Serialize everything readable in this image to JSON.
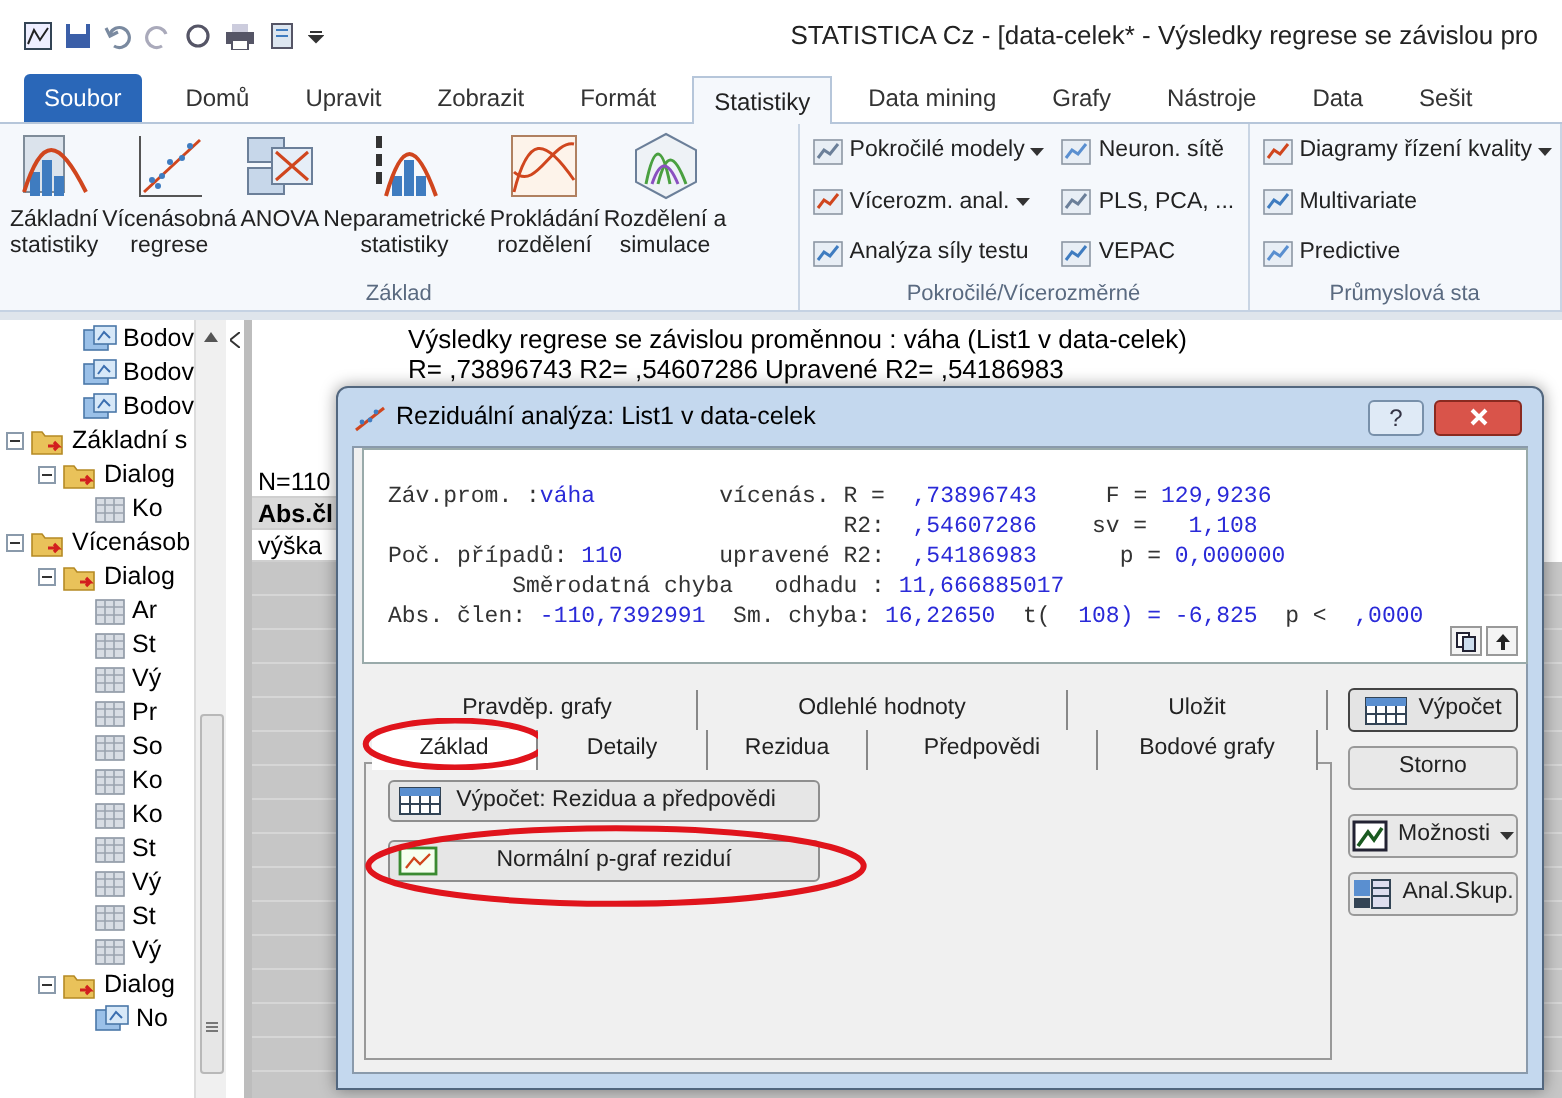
{
  "window": {
    "title": "STATISTICA Cz - [data-celek* - Výsledky regrese se závislou pro"
  },
  "ribbon_tabs": [
    {
      "label": "Soubor",
      "kind": "file",
      "selected": false
    },
    {
      "label": "Domů",
      "kind": "tab",
      "selected": false
    },
    {
      "label": "Upravit",
      "kind": "tab",
      "selected": false
    },
    {
      "label": "Zobrazit",
      "kind": "tab",
      "selected": false
    },
    {
      "label": "Formát",
      "kind": "tab",
      "selected": false
    },
    {
      "label": "Statistiky",
      "kind": "tab",
      "selected": true
    },
    {
      "label": "Data mining",
      "kind": "tab",
      "selected": false
    },
    {
      "label": "Grafy",
      "kind": "tab",
      "selected": false
    },
    {
      "label": "Nástroje",
      "kind": "tab",
      "selected": false
    },
    {
      "label": "Data",
      "kind": "tab",
      "selected": false
    },
    {
      "label": "Sešit",
      "kind": "tab",
      "selected": false
    }
  ],
  "ribbon_groups": [
    {
      "label": "Základ",
      "kind": "large",
      "items": [
        {
          "line1": "Základní",
          "line2": "statistiky"
        },
        {
          "line1": "Vícenásobná",
          "line2": "regrese"
        },
        {
          "line1": "ANOVA"
        },
        {
          "line1": "Neparametrické",
          "line2": "statistiky"
        },
        {
          "line1": "Prokládání",
          "line2": "rozdělení"
        },
        {
          "line1": "Rozdělení a",
          "line2": "simulace"
        }
      ]
    },
    {
      "label": "Pokročilé/Vícerozměrné",
      "kind": "small",
      "items": [
        {
          "label": "Pokročilé modely",
          "dropdown": true
        },
        {
          "label": "Vícerozm. anal.",
          "dropdown": true
        },
        {
          "label": "Analýza síly testu",
          "dropdown": false
        },
        {
          "label": "Neuron. sítě",
          "dropdown": false
        },
        {
          "label": "PLS, PCA, ...",
          "dropdown": false
        },
        {
          "label": "VEPAC",
          "dropdown": false
        }
      ]
    },
    {
      "label": "Průmyslová sta",
      "kind": "small",
      "items": [
        {
          "label": "Diagramy řízení kvality",
          "dropdown": true
        },
        {
          "label": "Multivariate",
          "dropdown": false
        },
        {
          "label": "Predictive",
          "dropdown": false
        }
      ]
    }
  ],
  "tree": {
    "continued_items": [
      {
        "label": "Bodov",
        "kind": "graph"
      },
      {
        "label": "Bodov",
        "kind": "graph"
      },
      {
        "label": "Bodov",
        "kind": "graph"
      }
    ],
    "nodes": [
      {
        "label": "Základní s",
        "kind": "folder",
        "expanded": true,
        "children": [
          {
            "label": "Dialog",
            "kind": "folder",
            "expanded": true,
            "children": [
              {
                "label": "Ko",
                "kind": "sheet"
              }
            ]
          }
        ]
      },
      {
        "label": "Vícenásob",
        "kind": "folder",
        "expanded": true,
        "children": [
          {
            "label": "Dialog",
            "kind": "folder",
            "expanded": true,
            "children": [
              {
                "label": "Ar",
                "kind": "sheet"
              },
              {
                "label": "St",
                "kind": "sheet"
              },
              {
                "label": "Vý",
                "kind": "sheet"
              },
              {
                "label": "Pr",
                "kind": "sheet"
              },
              {
                "label": "So",
                "kind": "sheet"
              },
              {
                "label": "Ko",
                "kind": "sheet"
              },
              {
                "label": "Ko",
                "kind": "sheet"
              },
              {
                "label": "St",
                "kind": "sheet"
              },
              {
                "label": "Vý",
                "kind": "sheet"
              },
              {
                "label": "St",
                "kind": "sheet"
              },
              {
                "label": "Vý",
                "kind": "sheet"
              }
            ]
          },
          {
            "label": "Dialog",
            "kind": "folder",
            "expanded": true,
            "children": [
              {
                "label": "No",
                "kind": "graph"
              }
            ]
          }
        ]
      }
    ]
  },
  "results_header": [
    "Výsledky regrese se závislou proměnnou :  váha (List1 v data-celek)",
    "R= ,73896743 R2= ,54607286 Upravené R2= ,54186983"
  ],
  "sheet": {
    "rows": [
      {
        "text": "N=110",
        "kind": "note"
      },
      {
        "text": "Abs.čl",
        "kind": "header"
      },
      {
        "text": "výška",
        "kind": "cell"
      }
    ]
  },
  "dialog": {
    "title": "Reziduální analýza: List1 v data-celek",
    "help": "?",
    "summary": [
      [
        {
          "text": "Záv.prom. :",
          "kind": "label"
        },
        {
          "text": "váha",
          "kind": "value"
        },
        {
          "text": "         vícenás. R =  ",
          "kind": "label"
        },
        {
          "text": ",73896743",
          "kind": "value"
        },
        {
          "text": "     F = ",
          "kind": "label"
        },
        {
          "text": "129,9236",
          "kind": "value"
        }
      ],
      [
        {
          "text": "                                 R2:  ",
          "kind": "label"
        },
        {
          "text": ",54607286",
          "kind": "value"
        },
        {
          "text": "    sv =   ",
          "kind": "label"
        },
        {
          "text": "1,108",
          "kind": "value"
        }
      ],
      [
        {
          "text": "Poč. případů: ",
          "kind": "label"
        },
        {
          "text": "110",
          "kind": "value"
        },
        {
          "text": "       upravené R2:  ",
          "kind": "label"
        },
        {
          "text": ",54186983",
          "kind": "value"
        },
        {
          "text": "      p = ",
          "kind": "label"
        },
        {
          "text": "0,000000",
          "kind": "value"
        }
      ],
      [
        {
          "text": "         Směrodatná chyba   odhadu : ",
          "kind": "label"
        },
        {
          "text": "11,666885017",
          "kind": "value"
        }
      ],
      [
        {
          "text": "Abs. člen: ",
          "kind": "label"
        },
        {
          "text": "-110,7392991",
          "kind": "value"
        },
        {
          "text": "  Sm. chyba: ",
          "kind": "label"
        },
        {
          "text": "16,22650",
          "kind": "value"
        },
        {
          "text": "  t(  ",
          "kind": "label"
        },
        {
          "text": "108) = -6,825",
          "kind": "value"
        },
        {
          "text": "  p <  ",
          "kind": "label"
        },
        {
          "text": ",0000",
          "kind": "value"
        }
      ]
    ],
    "tab_rows": [
      [
        {
          "label": "Pravděp. grafy",
          "selected": false,
          "circled": false
        },
        {
          "label": "Odlehlé hodnoty",
          "selected": false,
          "circled": false
        },
        {
          "label": "Uložit",
          "selected": false,
          "circled": false
        }
      ],
      [
        {
          "label": "Základ",
          "selected": true,
          "circled": true
        },
        {
          "label": "Detaily",
          "selected": false,
          "circled": false
        },
        {
          "label": "Rezidua",
          "selected": false,
          "circled": false
        },
        {
          "label": "Předpovědi",
          "selected": false,
          "circled": false
        },
        {
          "label": "Bodové grafy",
          "selected": false,
          "circled": false
        }
      ]
    ],
    "panel_buttons": [
      {
        "label": "Výpočet: Rezidua a předpovědi",
        "kind": "table",
        "circled": false
      },
      {
        "label": "Normální p-graf reziduí",
        "kind": "graph",
        "circled": true
      }
    ],
    "side_buttons": [
      {
        "label": "Výpočet",
        "kind": "run"
      },
      {
        "label": "Storno",
        "kind": "plain"
      },
      {
        "label": "Možnosti",
        "kind": "menu"
      },
      {
        "label": "Anal.Skup.",
        "kind": "group"
      }
    ]
  }
}
